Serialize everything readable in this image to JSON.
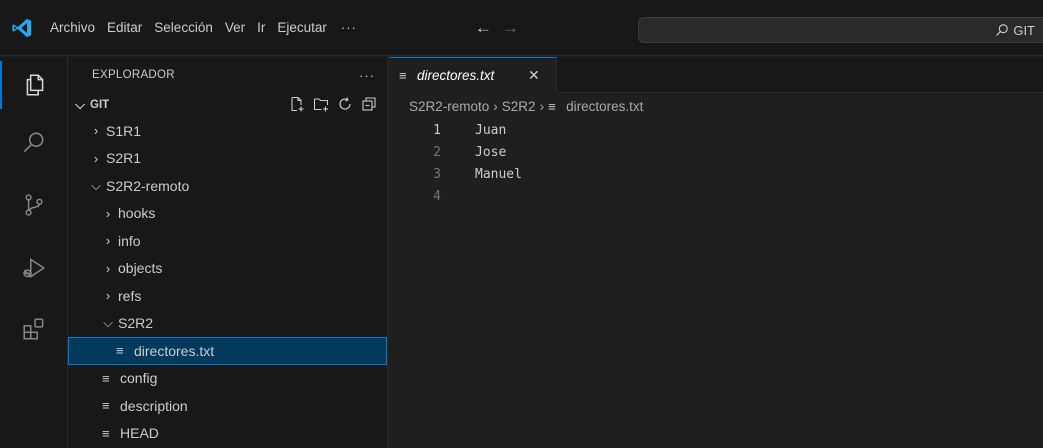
{
  "menu": {
    "items": [
      "Archivo",
      "Editar",
      "Selección",
      "Ver",
      "Ir",
      "Ejecutar"
    ],
    "more": "···"
  },
  "search": {
    "text": "GIT"
  },
  "sidebar": {
    "title": "EXPLORADOR",
    "more": "···",
    "section": "GIT",
    "tree": [
      {
        "label": "S1R1",
        "kind": "folder",
        "state": "collapsed"
      },
      {
        "label": "S2R1",
        "kind": "folder",
        "state": "collapsed"
      },
      {
        "label": "S2R2-remoto",
        "kind": "folder",
        "state": "expanded"
      },
      {
        "label": "hooks",
        "kind": "folder",
        "state": "collapsed"
      },
      {
        "label": "info",
        "kind": "folder",
        "state": "collapsed"
      },
      {
        "label": "objects",
        "kind": "folder",
        "state": "collapsed"
      },
      {
        "label": "refs",
        "kind": "folder",
        "state": "collapsed"
      },
      {
        "label": "S2R2",
        "kind": "folder",
        "state": "expanded"
      },
      {
        "label": "directores.txt",
        "kind": "file",
        "selected": true
      },
      {
        "label": "config",
        "kind": "file"
      },
      {
        "label": "description",
        "kind": "file"
      },
      {
        "label": "HEAD",
        "kind": "file"
      }
    ]
  },
  "editor": {
    "tab_label": "directores.txt",
    "breadcrumb": [
      "S2R2-remoto",
      "S2R2",
      "directores.txt"
    ],
    "lines": [
      {
        "n": "1",
        "text": "Juan"
      },
      {
        "n": "2",
        "text": "Jose"
      },
      {
        "n": "3",
        "text": "Manuel"
      },
      {
        "n": "4",
        "text": ""
      }
    ]
  },
  "colors": {
    "accent": "#0078d4",
    "selection": "#04395e",
    "logo": "#23a9f2"
  }
}
